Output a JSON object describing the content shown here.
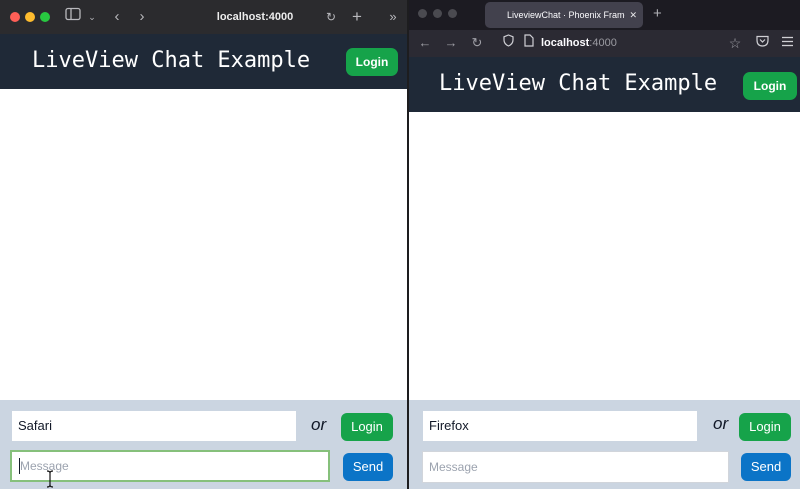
{
  "safari": {
    "address": "localhost:4000",
    "icons": {
      "sidebar": "sidebar-icon",
      "chevron": "chevron-down-icon",
      "back": "back-icon",
      "forward": "forward-icon",
      "reload": "reload-icon",
      "new_tab": "plus-icon",
      "overflow": "double-chevron-icon"
    },
    "app": {
      "title": "LiveView Chat Example",
      "login_label": "Login",
      "name_value": "Safari",
      "or_text": "or",
      "login_small_label": "Login",
      "message_placeholder": "Message",
      "send_label": "Send"
    }
  },
  "firefox": {
    "tab_title": "LiveviewChat · Phoenix Framew",
    "url_host": "localhost",
    "url_port": ":4000",
    "icons": {
      "back": "back-arrow-icon",
      "forward": "forward-arrow-icon",
      "reload": "reload-icon",
      "shield": "shield-icon",
      "page": "page-icon",
      "bookmark": "star-icon",
      "pocket": "pocket-icon",
      "menu": "menu-icon"
    },
    "app": {
      "title": "LiveView Chat Example",
      "login_label": "Login",
      "name_value": "Firefox",
      "or_text": "or",
      "login_small_label": "Login",
      "message_placeholder": "Message",
      "send_label": "Send"
    }
  },
  "colors": {
    "header_bg": "#1f2937",
    "login_green": "#16a34a",
    "send_blue": "#0b74c7",
    "footer_bg": "#cbd5e1"
  }
}
